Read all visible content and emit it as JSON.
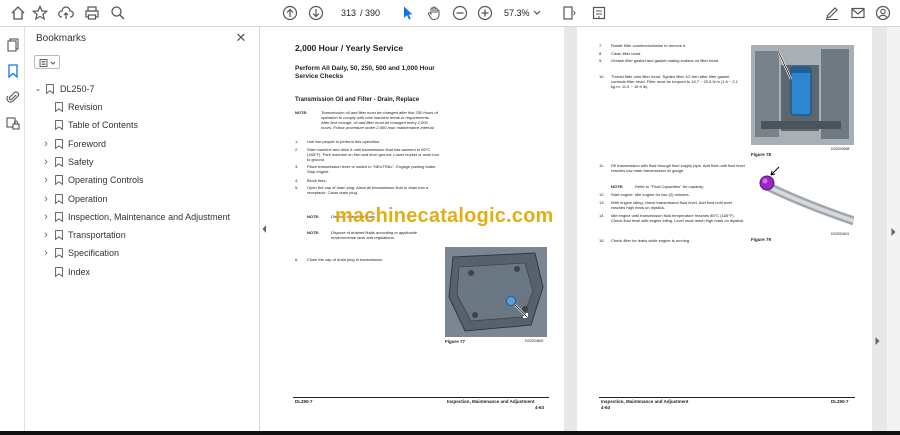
{
  "toolbar": {
    "current_page": "313",
    "total_pages": "/ 390",
    "zoom": "57.3%"
  },
  "bookmarks_panel": {
    "title": "Bookmarks",
    "root": "DL250-7",
    "items": [
      {
        "label": "Revision",
        "expandable": false
      },
      {
        "label": "Table of Contents",
        "expandable": false
      },
      {
        "label": "Foreword",
        "expandable": true
      },
      {
        "label": "Safety",
        "expandable": true
      },
      {
        "label": "Operating Controls",
        "expandable": true
      },
      {
        "label": "Operation",
        "expandable": true
      },
      {
        "label": "Inspection, Maintenance and Adjustment",
        "expandable": true
      },
      {
        "label": "Transportation",
        "expandable": true
      },
      {
        "label": "Specification",
        "expandable": true
      },
      {
        "label": "Index",
        "expandable": false
      }
    ]
  },
  "left_page": {
    "title": "2,000 Hour / Yearly Service",
    "subtitle": "Perform All Daily, 50, 250, 500 and 1,000 Hour Service Checks",
    "section": "Transmission Oil and Filter - Drain, Replace",
    "note1_label": "NOTE:",
    "note1_text": "Transmission oil and filter must be changed after first 250 hours of operation to comply with new machine break-in requirements. After first change, oil and filter must be changed every 2,000 hours. Follow procedure under 2,000 hour maintenance interval.",
    "steps": [
      {
        "n": "1.",
        "text": "Use two people to perform this operation."
      },
      {
        "n": "2.",
        "text": "Start machine and drive it until transmission fluid has warmed to 85°C (185°F). Park machine on firm and level ground. Lower bucket or work tool to ground."
      },
      {
        "n": "3.",
        "text": "Place transmission lever or switch in \"NEUTRAL\". Engage parking brake. Stop engine."
      },
      {
        "n": "4.",
        "text": "Block tires."
      },
      {
        "n": "5.",
        "text": "Open the cap of drain plug. Allow all transmission fluid to drain into a receptacle. Clean drain plug."
      },
      {
        "n": "6.",
        "text": "Close the cap of drain plug in transmission."
      }
    ],
    "note2_label": "NOTE:",
    "note2_text": "Dispose of drained fluids...",
    "note3_label": "NOTE:",
    "note3_text": "Dispose of drained fluids according to applicable environmental laws and regulations.",
    "figure_code": "DS2004802",
    "figure_caption": "Figure 77",
    "footer_left": "DL250-7",
    "footer_right": "Inspection, Maintenance and Adjustment",
    "footer_page": "4-63"
  },
  "right_page": {
    "steps": [
      {
        "n": "7.",
        "text": "Rotate filter counterclockwise to remove it."
      },
      {
        "n": "8.",
        "text": "Clean filter head."
      },
      {
        "n": "9.",
        "text": "Grease filter gasket and gasket mating surface on filter head."
      },
      {
        "n": "10.",
        "text": "Thread filter onto filter head. Tighten filter 1/2 turn after filter gasket contacts filter head. Filter must be torqued to 15.7 ~ 20.6 N.m (1.6 ~ 2.1 kg.m, 11.5 ~ 15 ft lb)."
      },
      {
        "n": "11.",
        "text": "Fill transmission with fluid through fluid supply pipe. Add fluid until fluid level reaches low mark transmission oil gauge."
      },
      {
        "n": "12.",
        "text": "Start engine. Idle engine for two (2) minutes."
      },
      {
        "n": "13.",
        "text": "With engine idling, check transmission fluid level. Add fluid until level reaches high mark on dipstick."
      },
      {
        "n": "14.",
        "text": "Idle engine until transmission fluid temperature reaches 85°C (185°F). Check fluid level with engine idling. Level must reach high mark on dipstick."
      },
      {
        "n": "15.",
        "text": "Check filter for leaks while engine is running."
      }
    ],
    "note_label": "NOTE:",
    "note_text": "Refer to \"Fluid Capacities\" for capacity.",
    "figure1_code": "DS2000698",
    "figure1_caption": "Figure 78",
    "figure2_code": "DS2004401",
    "figure2_caption": "Figure 79",
    "footer_left": "Inspection, Maintenance and Adjustment",
    "footer_page": "4-64",
    "footer_right": "DL250-7"
  },
  "watermark": "machinecatalogic.com"
}
